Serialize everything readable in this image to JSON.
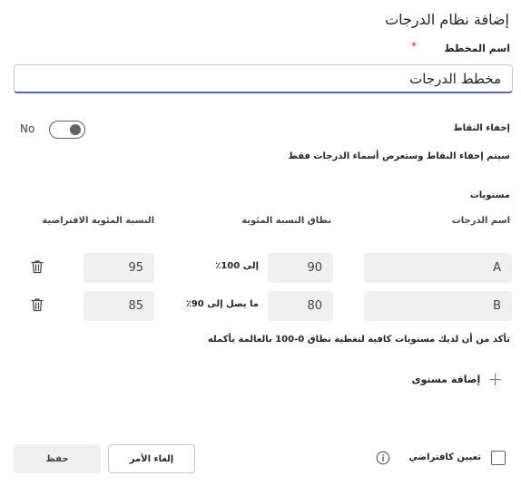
{
  "dialog": {
    "title": "إضافة نظام الدرجات",
    "scheme_name_label": "اسم المخطط",
    "required_mark": "*",
    "scheme_name_value": "مخطط الدرجات",
    "hide_points_label": "إخفاء النقاط",
    "toggle_state": "No",
    "hide_points_description": "سيتم إخفاء النقاط وستعرض أسماء الدرجات فقط",
    "levels_title": "مستويات",
    "columns": {
      "grade_name": "اسم الدرجات",
      "percentage_range": "نطاق النسبة المئوية",
      "default_percentage": "النسبة المئوية الافتراضية"
    },
    "levels": [
      {
        "name": "A",
        "min": "90",
        "range_label": "إلى 100٪",
        "default": "95"
      },
      {
        "name": "B",
        "min": "80",
        "range_label": "ما يصل إلى 90٪",
        "default": "85"
      }
    ],
    "coverage_note": "تأكد من أن لديك مستويات كافية لتغطية نطاق 0-100 بالعالمة بأكمله",
    "add_level_label": "إضافة مستوى",
    "set_default_label": "تعيين كافتراضي",
    "cancel_label": "إلغاء الأمر",
    "save_label": "حفظ",
    "icons": {
      "trash": "trash-icon",
      "info": "info-icon",
      "plus": "plus-icon"
    },
    "colors": {
      "accent": "#6264a7",
      "required": "#c4314b"
    }
  }
}
